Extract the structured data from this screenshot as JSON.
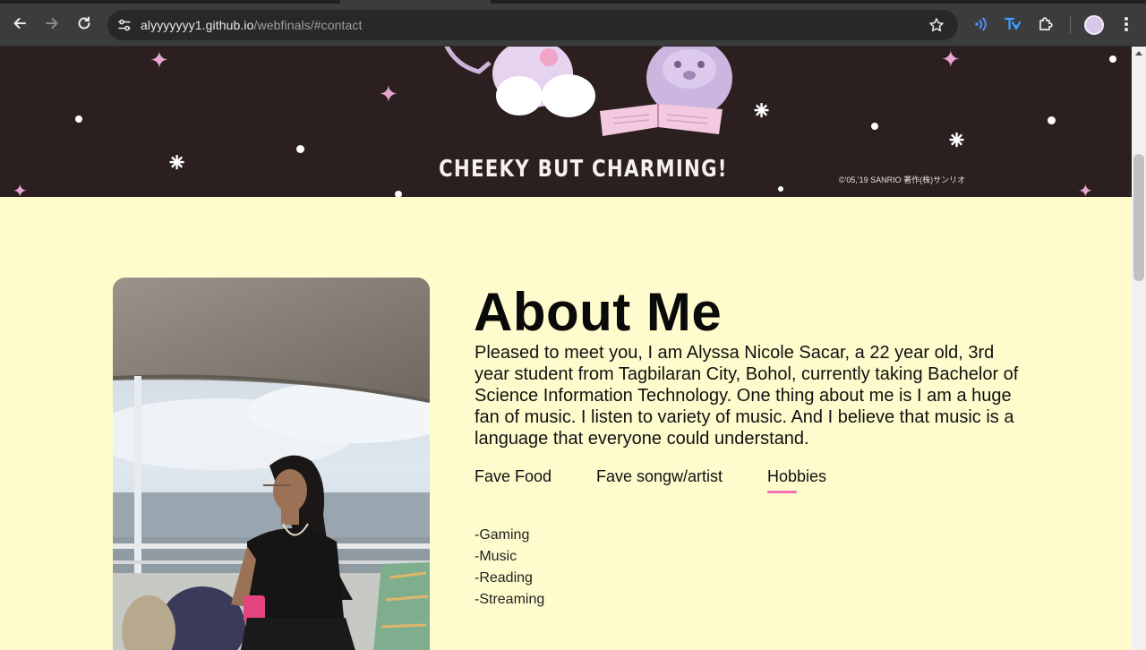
{
  "browser": {
    "url_host": "alyyyyyyy1.github.io",
    "url_path": "/webfinals/#contact"
  },
  "banner": {
    "tagline": "CHEEKY BUT CHARMING!",
    "copyright": "©'05,'19 SANRIO   著作(株)サンリオ"
  },
  "about": {
    "title": "About Me",
    "paragraph": "Pleased to meet you, I am Alyssa Nicole Sacar, a 22 year old, 3rd year student from Tagbilaran City, Bohol, currently taking Bachelor of Science Information Technology. One thing about me is I am a huge fan of music. I listen to variety of music. And I believe that music is a language that everyone could understand.",
    "tabs": [
      "Fave Food",
      "Fave songw/artist",
      "Hobbies"
    ],
    "active_tab": "Hobbies",
    "hobbies": [
      "-Gaming",
      "-Music",
      "-Reading",
      "-Streaming"
    ]
  },
  "colors": {
    "page_bg": "#fefccd",
    "banner_bg": "#2b1f20",
    "tab_accent": "#f06fb5"
  }
}
